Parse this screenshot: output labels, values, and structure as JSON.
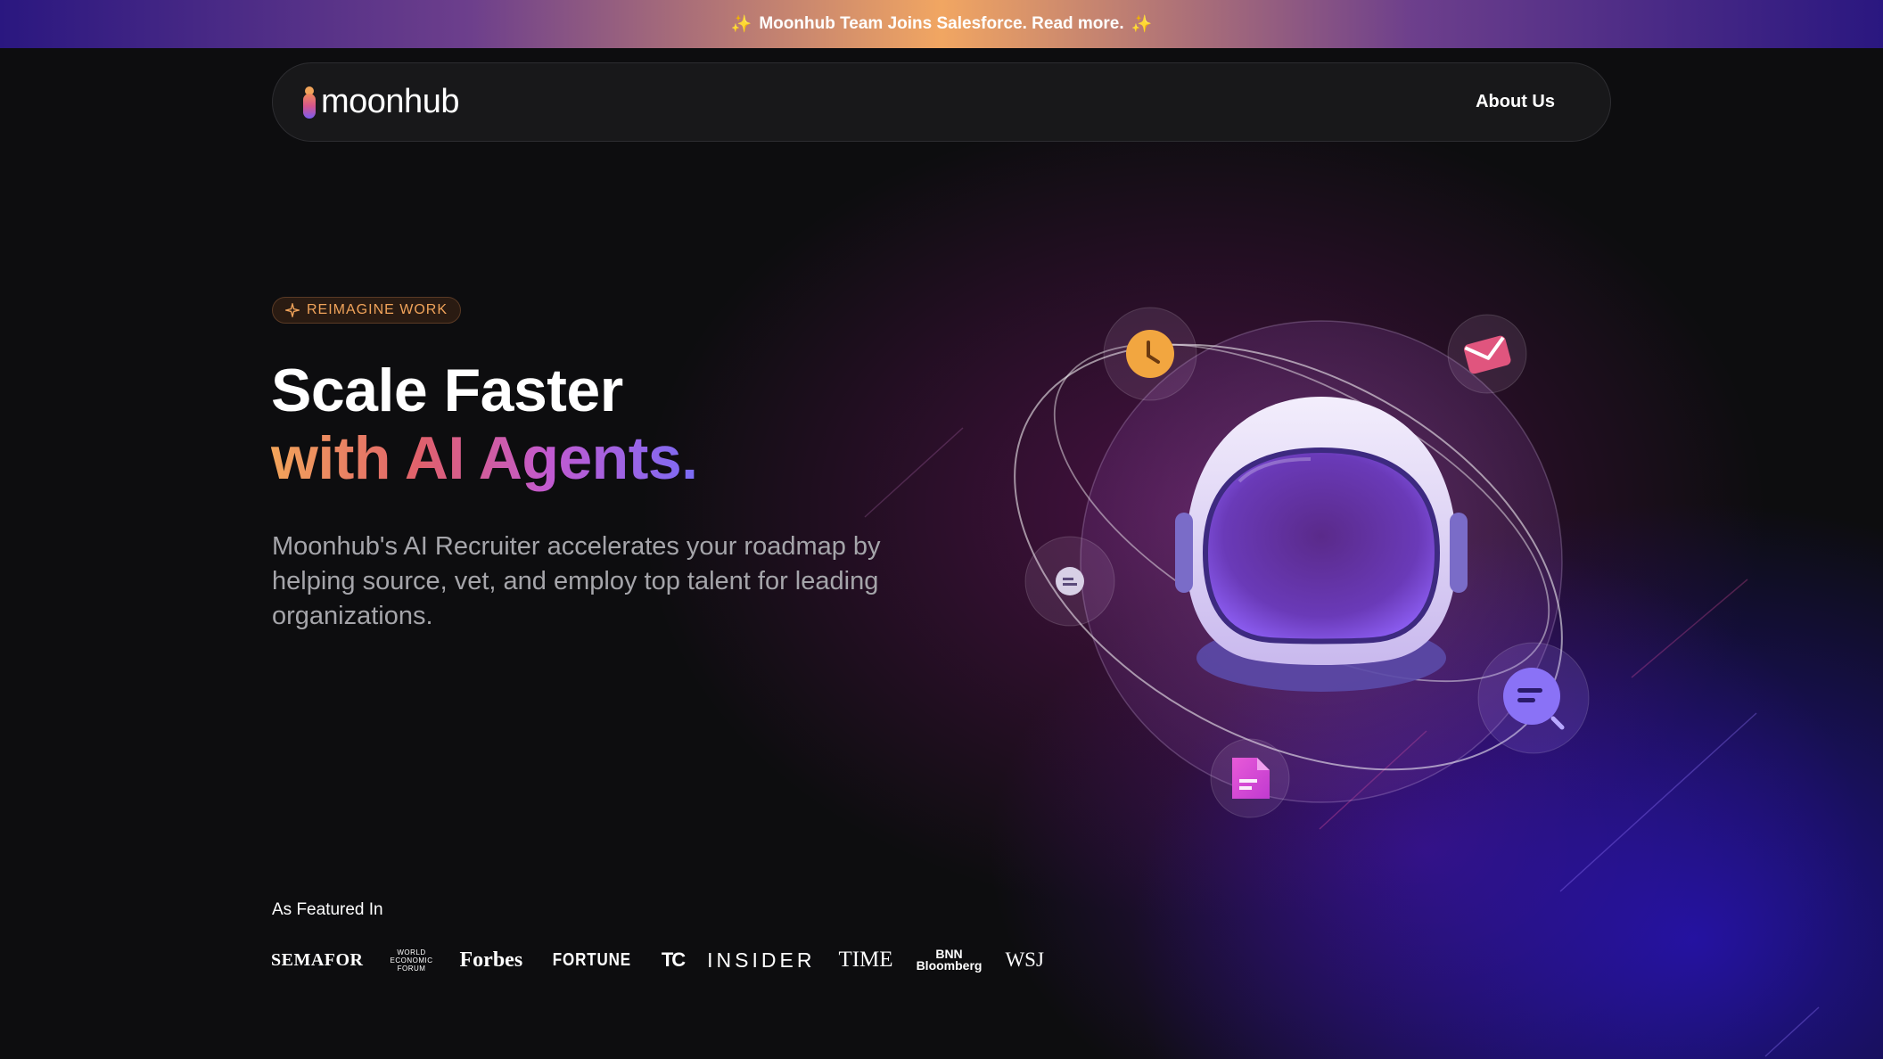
{
  "banner": {
    "spark_left": "✨",
    "text": "Moonhub Team Joins Salesforce. Read more.",
    "spark_right": "✨"
  },
  "nav": {
    "logo_text": "moonhub",
    "about_link": "About Us"
  },
  "hero": {
    "badge": "REIMAGINE WORK",
    "title_line1": "Scale Faster",
    "title_line2": "with AI Agents.",
    "subtitle": "Moonhub's AI Recruiter accelerates your roadmap by helping source, vet, and employ top talent for leading organizations."
  },
  "featured": {
    "label": "As Featured In",
    "logos": {
      "semafor": "SEMAFOR",
      "wef_line1": "WORLD",
      "wef_line2": "ECONOMIC",
      "wef_line3": "FORUM",
      "forbes": "Forbes",
      "fortune": "FORTUNE",
      "techcrunch": "TC",
      "insider": "INSIDER",
      "time": "TIME",
      "bnn_line1": "BNN",
      "bnn_line2": "Bloomberg",
      "wsj": "WSJ"
    }
  },
  "colors": {
    "accent_orange": "#f0a35a",
    "accent_pink": "#d6558c",
    "accent_purple": "#7a6cf5",
    "background": "#0d0d0f"
  },
  "icons": [
    "sparkle-icon",
    "clock-icon",
    "mail-icon",
    "chat-icon",
    "search-icon",
    "document-icon",
    "astronaut-helmet-icon"
  ]
}
